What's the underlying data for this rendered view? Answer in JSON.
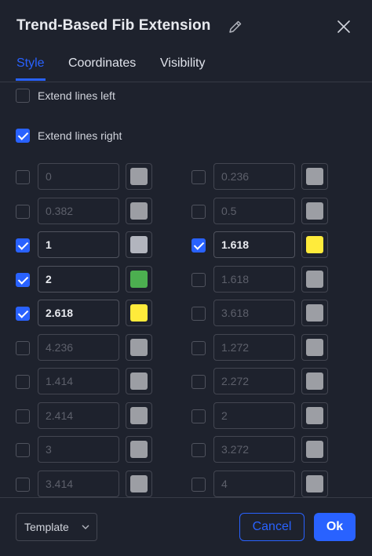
{
  "dialog": {
    "title": "Trend-Based Fib Extension"
  },
  "tabs": [
    {
      "label": "Style",
      "active": true
    },
    {
      "label": "Coordinates",
      "active": false
    },
    {
      "label": "Visibility",
      "active": false
    }
  ],
  "options": {
    "extend_left": {
      "label": "Extend lines left",
      "checked": false
    },
    "extend_right": {
      "label": "Extend lines right",
      "checked": true
    }
  },
  "levels": [
    {
      "value": "0",
      "enabled": false,
      "color": "#9c9ea4"
    },
    {
      "value": "0.236",
      "enabled": false,
      "color": "#9c9ea4"
    },
    {
      "value": "0.382",
      "enabled": false,
      "color": "#9c9ea4"
    },
    {
      "value": "0.5",
      "enabled": false,
      "color": "#9c9ea4"
    },
    {
      "value": "1",
      "enabled": true,
      "color": "#b2b5be"
    },
    {
      "value": "1.618",
      "enabled": true,
      "color": "#ffeb3b"
    },
    {
      "value": "2",
      "enabled": true,
      "color": "#4caf50"
    },
    {
      "value": "1.618",
      "enabled": false,
      "color": "#9c9ea4"
    },
    {
      "value": "2.618",
      "enabled": true,
      "color": "#ffeb3b"
    },
    {
      "value": "3.618",
      "enabled": false,
      "color": "#9c9ea4"
    },
    {
      "value": "4.236",
      "enabled": false,
      "color": "#9c9ea4"
    },
    {
      "value": "1.272",
      "enabled": false,
      "color": "#9c9ea4"
    },
    {
      "value": "1.414",
      "enabled": false,
      "color": "#9c9ea4"
    },
    {
      "value": "2.272",
      "enabled": false,
      "color": "#9c9ea4"
    },
    {
      "value": "2.414",
      "enabled": false,
      "color": "#9c9ea4"
    },
    {
      "value": "2",
      "enabled": false,
      "color": "#9c9ea4"
    },
    {
      "value": "3",
      "enabled": false,
      "color": "#9c9ea4"
    },
    {
      "value": "3.272",
      "enabled": false,
      "color": "#9c9ea4"
    },
    {
      "value": "3.414",
      "enabled": false,
      "color": "#9c9ea4"
    },
    {
      "value": "4",
      "enabled": false,
      "color": "#9c9ea4"
    }
  ],
  "footer": {
    "template_label": "Template",
    "cancel_label": "Cancel",
    "ok_label": "Ok"
  },
  "colors": {
    "accent": "#2962ff",
    "background": "#1e222d"
  }
}
